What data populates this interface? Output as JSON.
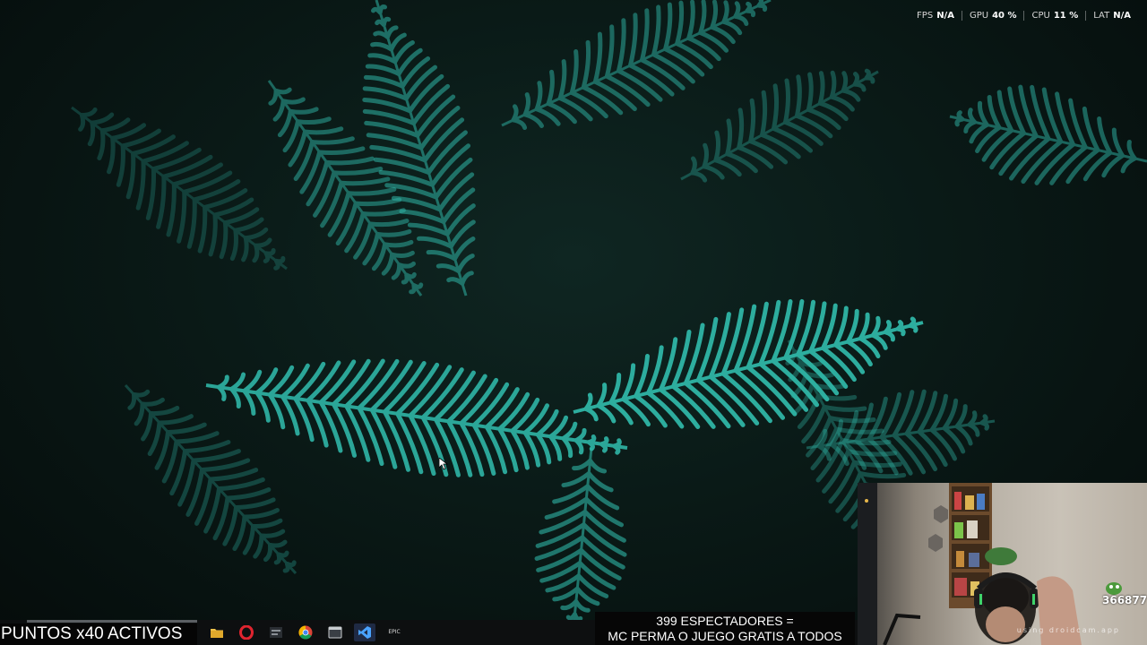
{
  "wallpaper": {
    "subject": "fern-leaves",
    "accent_color": "#2fb5a6",
    "background_color": "#07110f"
  },
  "performance_overlay": {
    "items": [
      {
        "label": "FPS",
        "value": "N/A"
      },
      {
        "label": "GPU",
        "value": "40 %"
      },
      {
        "label": "CPU",
        "value": "11 %"
      },
      {
        "label": "LAT",
        "value": "N/A"
      }
    ]
  },
  "taskbar": {
    "background_color": "#0d0f10",
    "icons": [
      {
        "name": "file-explorer-icon",
        "label": ""
      },
      {
        "name": "opera-browser-icon",
        "label": ""
      },
      {
        "name": "app-icon",
        "label": ""
      },
      {
        "name": "chrome-icon",
        "label": ""
      },
      {
        "name": "window-app-icon",
        "label": ""
      },
      {
        "name": "visual-studio-icon",
        "label": ""
      },
      {
        "name": "app-icon",
        "label": "EPIC"
      }
    ]
  },
  "stream_overlay": {
    "points_text": "PUNTOS x40 ACTIVOS",
    "banner_line1": "399 ESPECTADORES =",
    "banner_line2": "MC PERMA O JUEGO GRATIS A TODOS"
  },
  "webcam": {
    "watermark": "using droidcam.app",
    "counter": "366877"
  }
}
